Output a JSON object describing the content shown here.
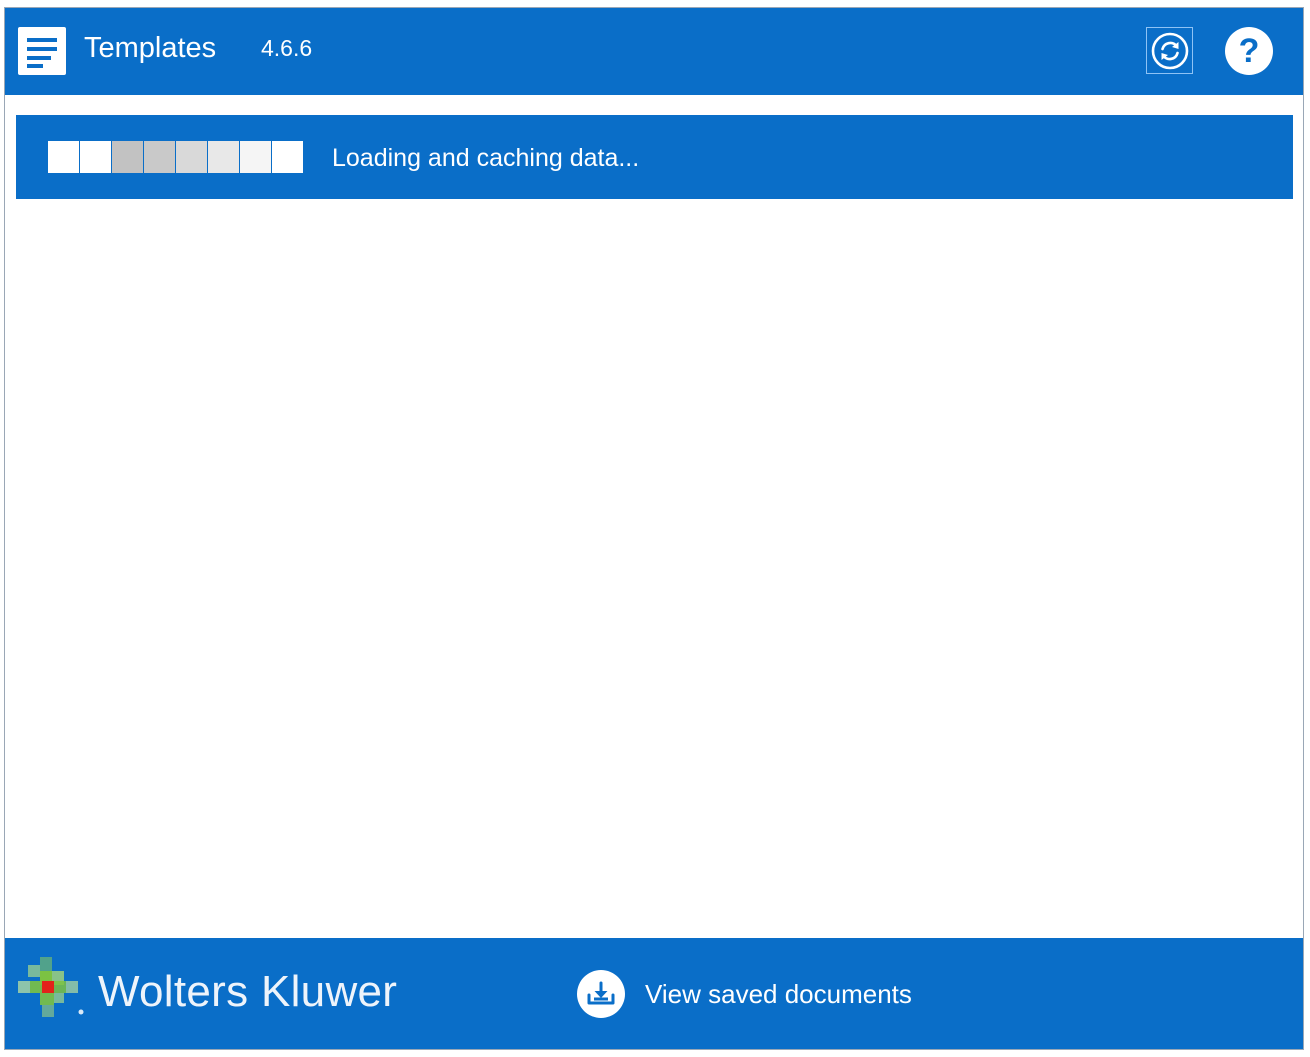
{
  "header": {
    "title": "Templates",
    "version": "4.6.6",
    "app_icon": "document-lines-icon",
    "refresh_icon": "refresh-icon",
    "help_icon": "help-icon",
    "help_glyph": "?"
  },
  "status": {
    "message": "Loading and caching data...",
    "loader_icon": "loading-blocks-icon"
  },
  "footer": {
    "brand_name": "Wolters Kluwer",
    "brand_logo": "wolters-kluwer-logo",
    "saved_docs_label": "View saved documents",
    "saved_docs_icon": "download-tray-icon"
  },
  "colors": {
    "brand_blue": "#0a6ec8",
    "text_on_blue": "#ffffff",
    "logo_green": "#7cc242",
    "logo_red": "#e2231a"
  }
}
